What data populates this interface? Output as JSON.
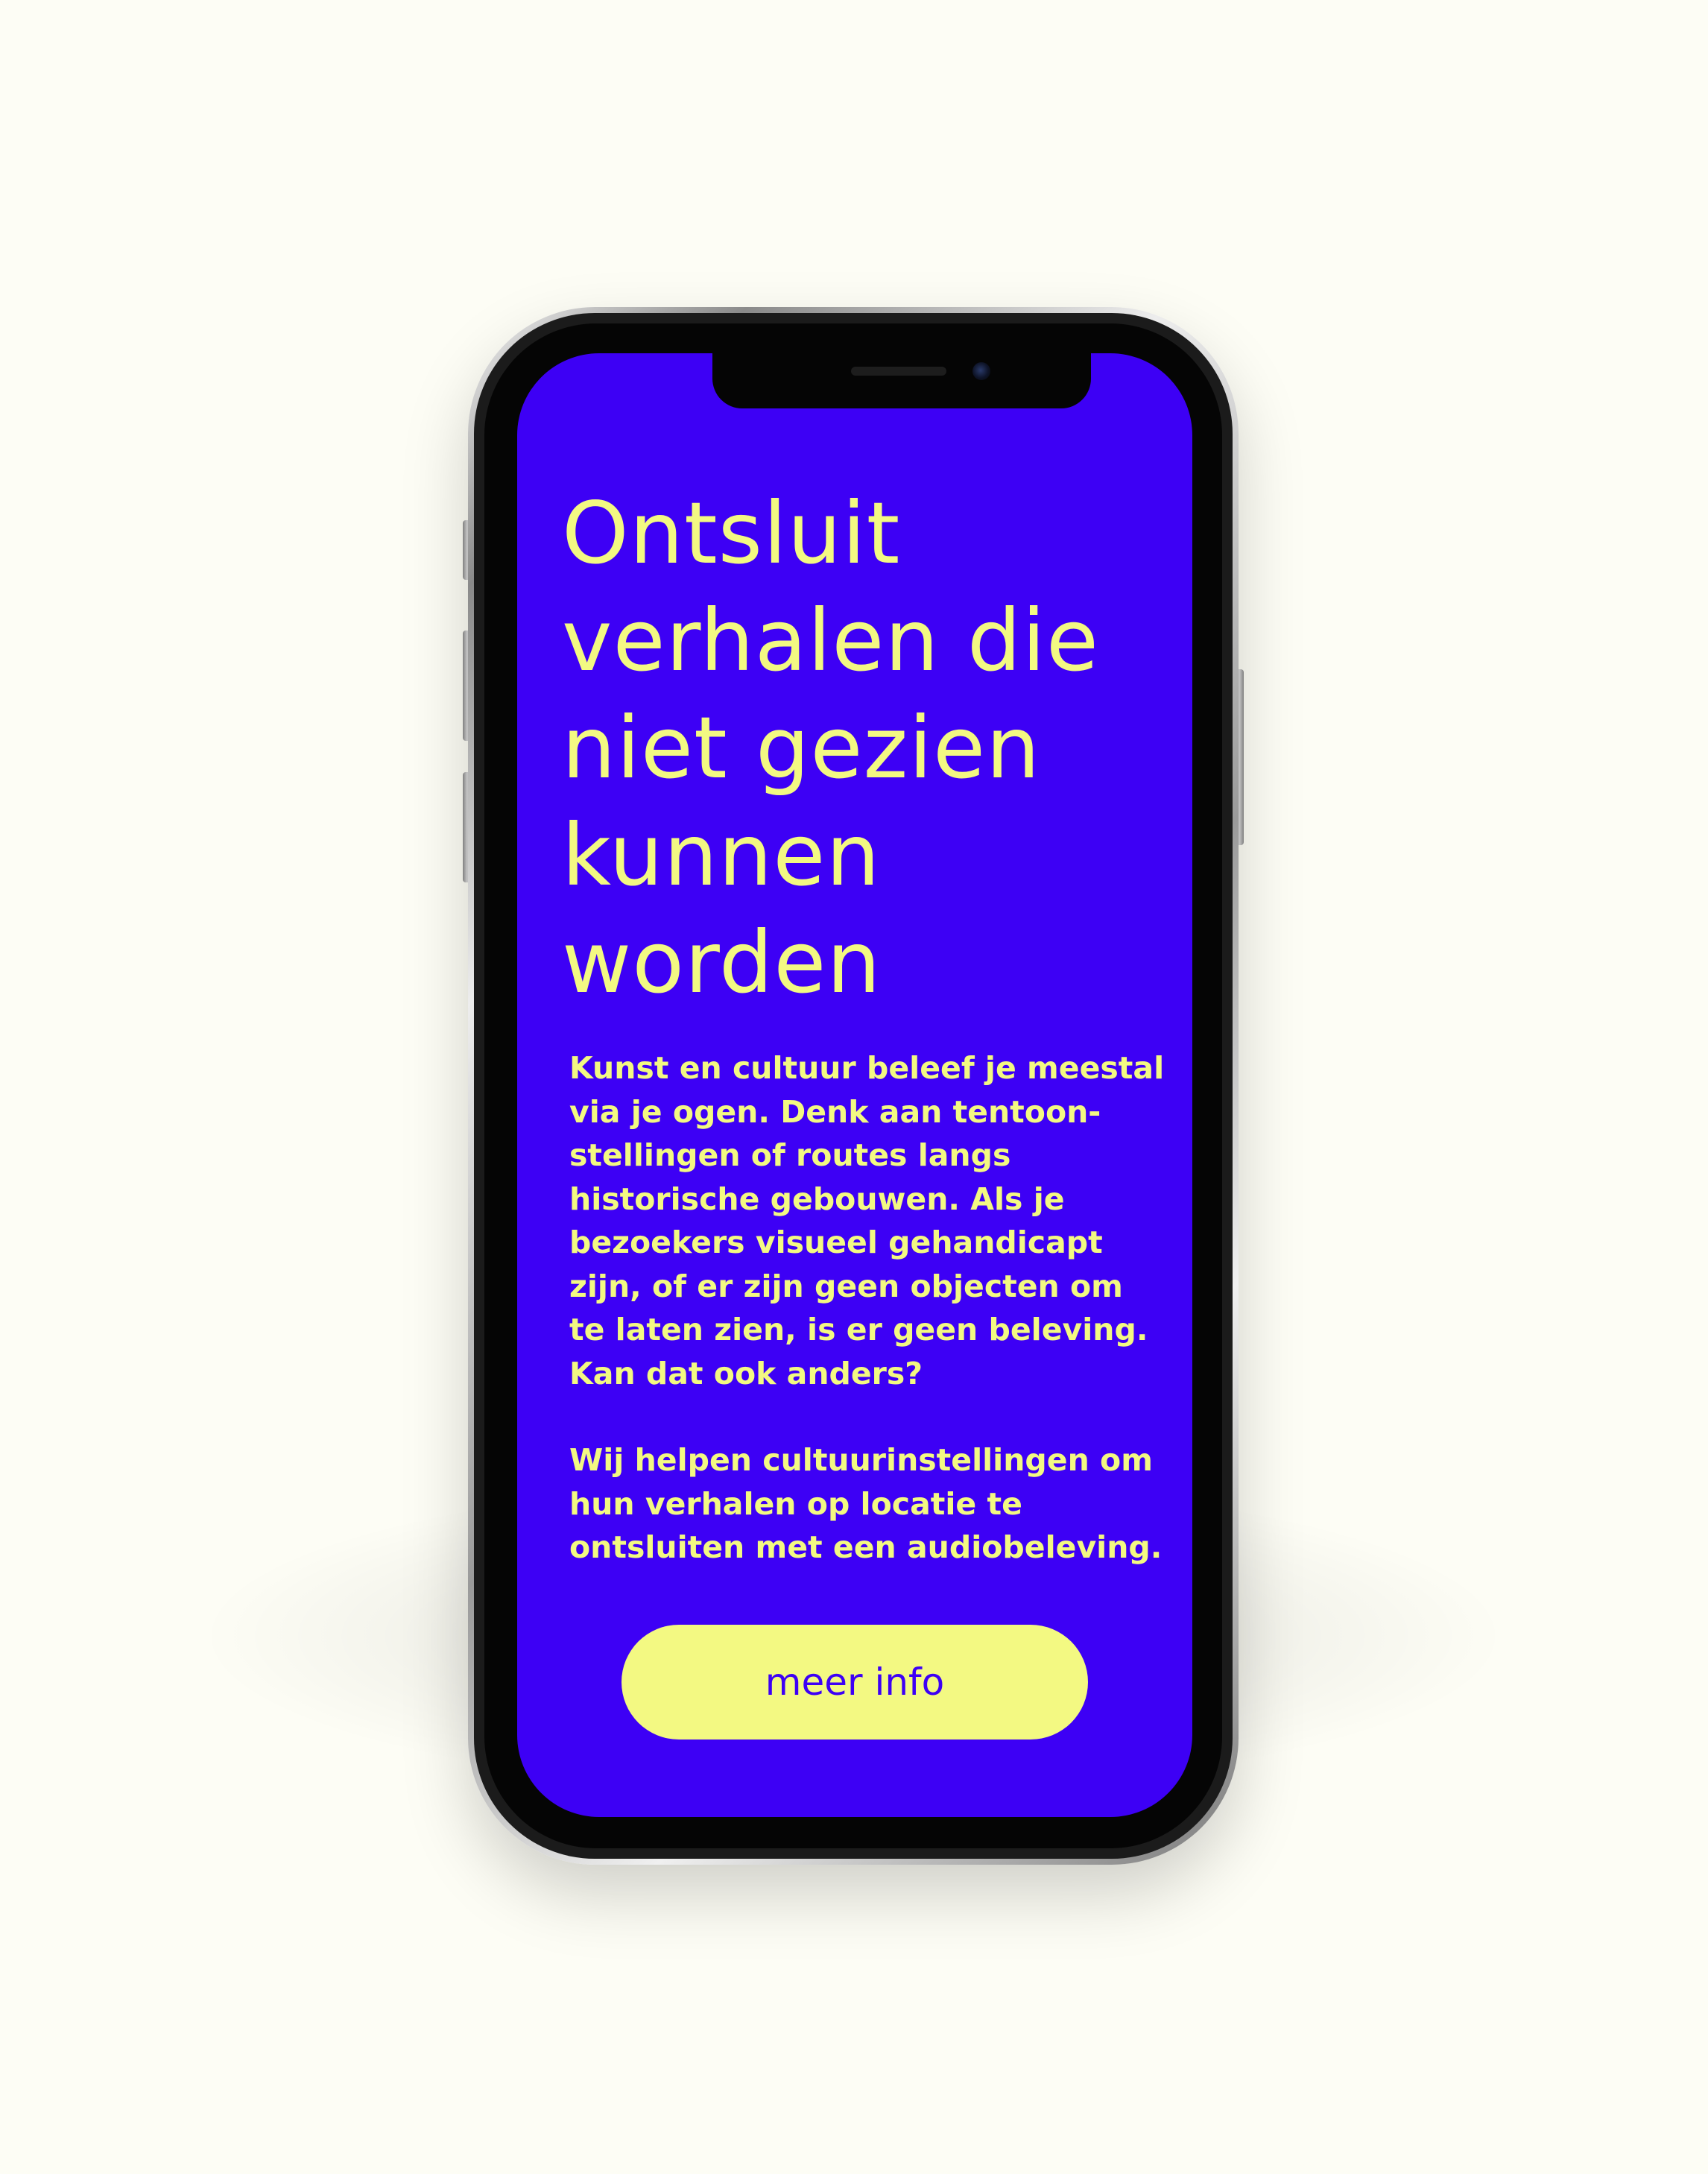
{
  "screen": {
    "title": "Ontsluit verhalen die niet gezien kunnen worden",
    "paragraphs": [
      "Kunst en cultuur beleef je meestal via je ogen. Denk aan tentoon-stellingen of routes langs historische gebouwen. Als je bezoekers visueel gehandicapt zijn, of er zijn geen objecten om te laten zien, is er geen beleving. Kan dat ook anders?",
      "Wij helpen cultuurinstellingen om hun verhalen op locatie te ontsluiten met een audiobeleving."
    ],
    "cta_label": "meer info"
  },
  "colors": {
    "page_background": "#fdfdf5",
    "screen_background": "#3d00f5",
    "accent_text": "#f3f982",
    "button_background": "#f3f982",
    "button_text": "#3d00f5"
  }
}
